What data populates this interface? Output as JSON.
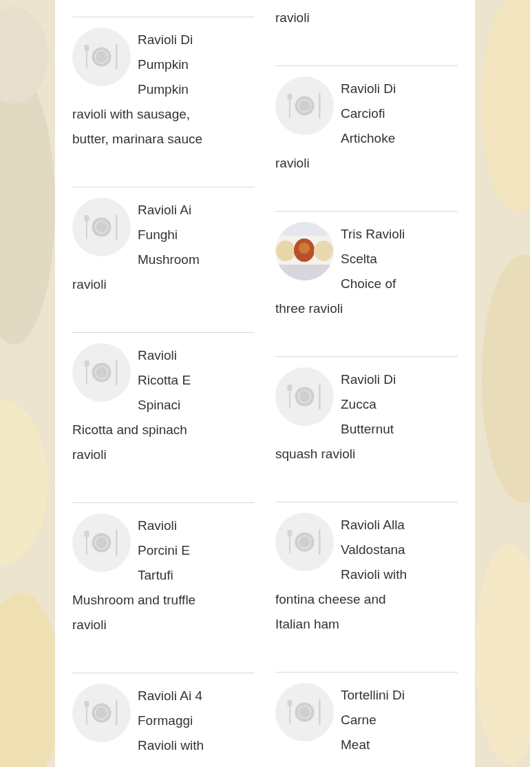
{
  "columns": [
    {
      "items": [
        {
          "name": "Ravioli Di Pumpkin",
          "description": "Pumpkin ravioli with sausage, butter, marinara sauce"
        },
        {
          "name": "Ravioli Ai Funghi",
          "description": "Mushroom ravioli"
        },
        {
          "name": "Ravioli Ricotta E Spinaci",
          "description": "Ricotta and spinach ravioli"
        },
        {
          "name": "Ravioli Porcini E Tartufi",
          "description": "Mushroom and truffle ravioli"
        },
        {
          "name": "Ravioli Ai 4 Formaggi",
          "description": "Ravioli with"
        }
      ]
    },
    {
      "partial_top": "ravioli",
      "items": [
        {
          "name": "Ravioli Di Carciofi",
          "description": "Artichoke ravioli"
        },
        {
          "kind": "picture",
          "name": "Tris Ravioli Scelta",
          "description": "Choice of three ravioli"
        },
        {
          "name": "Ravioli Di Zucca",
          "description": "Butternut squash ravioli"
        },
        {
          "name": "Ravioli Alla Valdostana",
          "description": "Ravioli with fontina cheese and Italian ham"
        },
        {
          "name": "Tortellini Di Carne",
          "description": "Meat"
        }
      ]
    }
  ]
}
